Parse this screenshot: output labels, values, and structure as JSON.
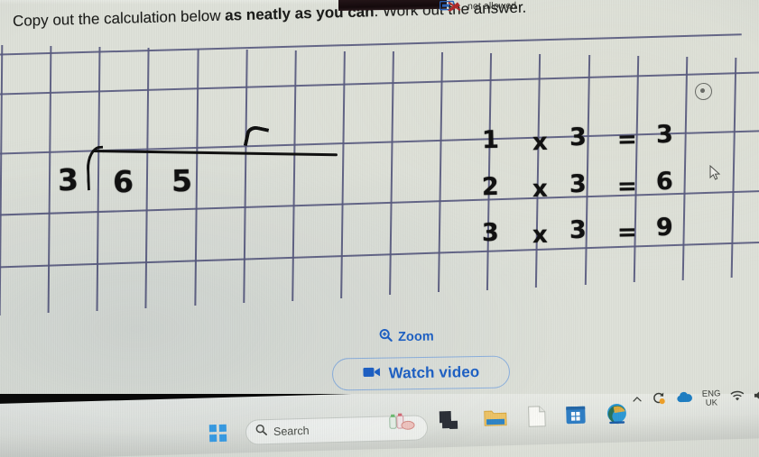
{
  "window": {
    "status_chip": {
      "label": "not allowed",
      "icon": "cast-not-allowed-icon"
    }
  },
  "worksheet": {
    "instruction_plain_1": "Copy out the calculation below ",
    "instruction_bold": "as neatly as you can",
    "instruction_plain_2": ". Work out the answer.",
    "grid": {
      "columns": 15,
      "rows": 5,
      "line_color": "#585a80",
      "paper_color": "#dfe2da"
    },
    "handwriting": {
      "divisor": "3",
      "dividend_digits": [
        "6",
        "5"
      ],
      "quotient_partial": "r",
      "bracket": "division-bracket"
    },
    "times_table": {
      "rows": [
        {
          "factor_a": "1",
          "operator": "x",
          "factor_b": "3",
          "equals": "=",
          "product": "3"
        },
        {
          "factor_a": "2",
          "operator": "x",
          "factor_b": "3",
          "equals": "=",
          "product": "6"
        },
        {
          "factor_a": "3",
          "operator": "x",
          "factor_b": "3",
          "equals": "=",
          "product": "9"
        }
      ]
    },
    "corner_glyph": "target-dot-icon"
  },
  "actions": {
    "zoom": {
      "label": "Zoom",
      "icon": "zoom-in-icon",
      "color": "#1f63c8"
    },
    "watch_video": {
      "label": "Watch video",
      "icon": "video-camera-icon",
      "color": "#1f63c8"
    }
  },
  "taskbar": {
    "start": {
      "name": "windows-start-button",
      "icon": "windows-logo-icon"
    },
    "search": {
      "placeholder": "Search",
      "icon": "search-icon"
    },
    "apps": [
      {
        "name": "copilot-app-icon"
      },
      {
        "name": "task-view-icon"
      },
      {
        "name": "file-explorer-icon"
      },
      {
        "name": "document-app-icon"
      },
      {
        "name": "microsoft-store-icon"
      },
      {
        "name": "microsoft-edge-icon"
      }
    ],
    "tray": {
      "overflow": {
        "icon": "chevron-up-icon"
      },
      "sync": {
        "icon": "sync-status-icon"
      },
      "onedrive": {
        "icon": "onedrive-cloud-icon"
      },
      "language_line1": "ENG",
      "language_line2": "UK",
      "wifi": {
        "icon": "wifi-icon"
      },
      "volume": {
        "icon": "volume-icon"
      }
    }
  }
}
